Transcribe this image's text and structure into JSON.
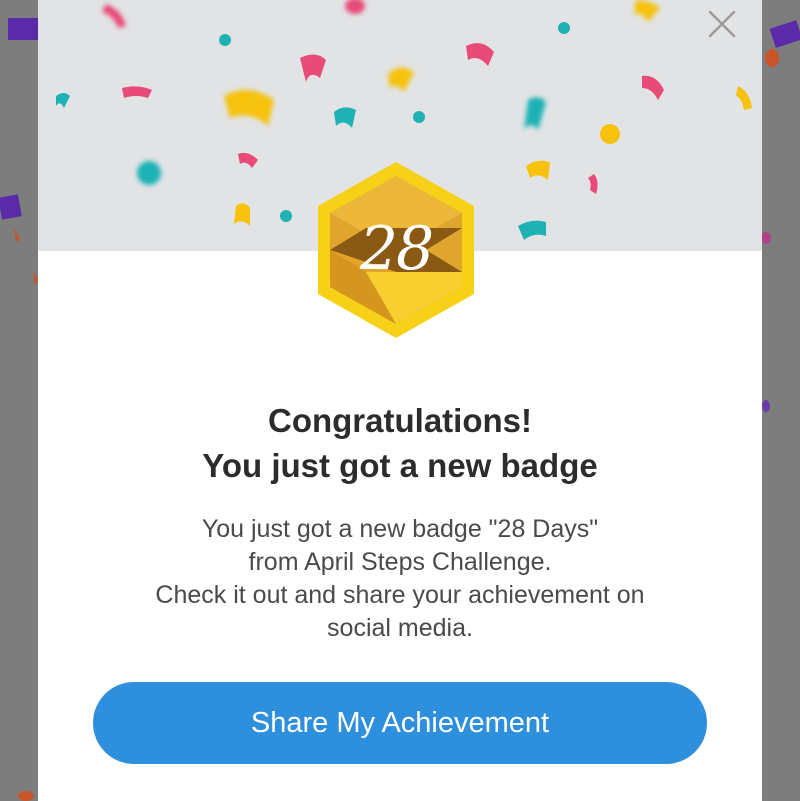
{
  "modal": {
    "close_icon": "close-icon",
    "badge": {
      "number": "28",
      "icon": "hexagon-badge-icon",
      "colors": {
        "outer": "#f7d117",
        "gold": "#e2a92a",
        "dark": "#8a5a14",
        "light": "#fbd43a"
      }
    },
    "title": {
      "line1": "Congratulations!",
      "line2": "You just got a new badge"
    },
    "message": {
      "line1": "You just got a new badge \"28 Days\"",
      "line2": "from April Steps Challenge.",
      "line3": "Check it out and share your achievement on",
      "line4": "social media."
    },
    "share_button_label": "Share My Achievement"
  },
  "colors": {
    "overlay": "#7d7d7e",
    "header_bg": "#e1e3e5",
    "button": "#2e8fdd",
    "confetti": [
      "#e84b78",
      "#1fb2b5",
      "#f6c20e",
      "#5b2aa8",
      "#c8542a"
    ]
  }
}
